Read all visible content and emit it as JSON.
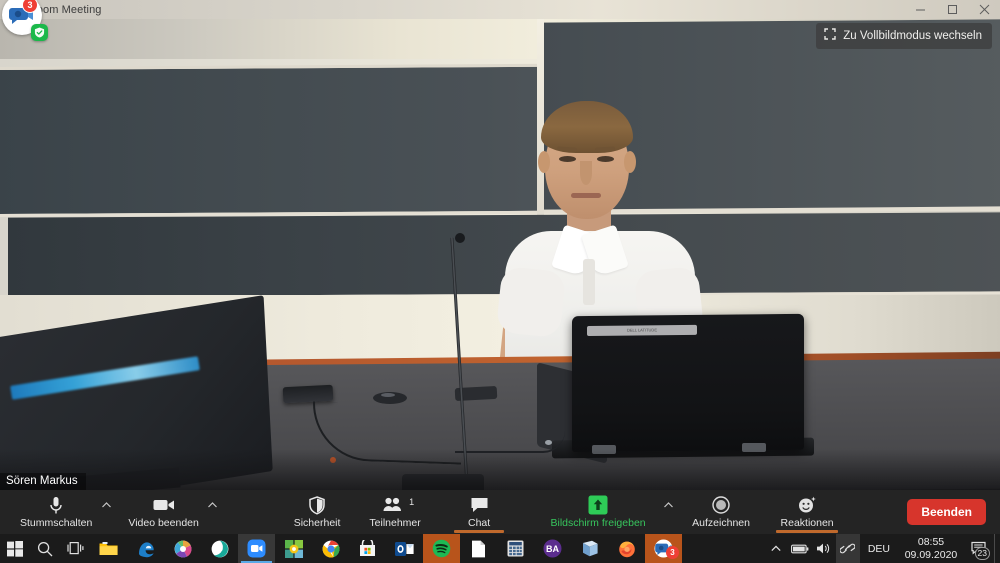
{
  "window": {
    "title": "Zoom Meeting",
    "controls": {
      "minimize": "minimize-icon",
      "maximize": "maximize-icon",
      "close": "close-icon"
    }
  },
  "overlay": {
    "app_icon": "zoom-chat-bubble-icon",
    "notification_count": "3",
    "shield_icon": "shield-check-icon"
  },
  "video": {
    "fullscreen_label": "Zu Vollbildmodus wechseln",
    "fullscreen_icon": "expand-icon",
    "participant_name": "Sören Markus",
    "laptop_strip_text": "DELL LATITUDE"
  },
  "toolbar": {
    "mute": {
      "label": "Stummschalten",
      "icon": "microphone-icon"
    },
    "video": {
      "label": "Video beenden",
      "icon": "video-camera-icon"
    },
    "security": {
      "label": "Sicherheit",
      "icon": "shield-icon"
    },
    "participants": {
      "label": "Teilnehmer",
      "icon": "people-icon",
      "count": "1"
    },
    "chat": {
      "label": "Chat",
      "icon": "chat-bubble-icon",
      "active": true
    },
    "share": {
      "label": "Bildschirm freigeben",
      "icon": "share-screen-icon",
      "color": "#37c55d"
    },
    "record": {
      "label": "Aufzeichnen",
      "icon": "record-circle-icon"
    },
    "reactions": {
      "label": "Reaktionen",
      "icon": "smiley-reaction-icon",
      "active": true
    },
    "end": {
      "label": "Beenden",
      "color": "#d7352c"
    },
    "caret_icon": "chevron-up-icon",
    "active_underline_color": "#c0692c"
  },
  "taskbar": {
    "start": "windows-start-icon",
    "search": "search-icon",
    "taskview": "task-view-icon",
    "apps": [
      {
        "name": "file-explorer",
        "glyph": "",
        "color": "#ffb900"
      },
      {
        "name": "microsoft-edge-legacy",
        "glyph": "e",
        "color": "#1a74c4"
      },
      {
        "name": "colorful-circle-app",
        "glyph": "",
        "color": "#d94a8c"
      },
      {
        "name": "teal-circle-app",
        "glyph": "",
        "color": "#18a999"
      },
      {
        "name": "zoom",
        "glyph": "",
        "color": "#2d8cff",
        "active": true
      },
      {
        "name": "green-yellow-squares-app",
        "glyph": "",
        "color": "#7cc242"
      },
      {
        "name": "google-chrome",
        "glyph": "",
        "color": "#4285f4"
      },
      {
        "name": "microsoft-store",
        "glyph": "",
        "color": "#ffffff"
      },
      {
        "name": "outlook",
        "glyph": "O",
        "color": "#0f4b8f"
      },
      {
        "name": "spotify",
        "glyph": "",
        "color": "#1db954",
        "active_orange": true
      },
      {
        "name": "document-app",
        "glyph": "",
        "color": "#ffffff"
      },
      {
        "name": "calculator",
        "glyph": "",
        "color": "#3f6fa8"
      },
      {
        "name": "ba-app",
        "glyph": "BA",
        "color": "#5b2d8e"
      },
      {
        "name": "blue-book-app",
        "glyph": "",
        "color": "#9dc3e6"
      },
      {
        "name": "firefox",
        "glyph": "",
        "color": "#ff7139"
      },
      {
        "name": "zoom-chat",
        "glyph": "",
        "color": "#2d8cff",
        "active_orange": true,
        "badge": "3"
      }
    ],
    "tray": {
      "chevron": "chevron-up-icon",
      "battery": "battery-icon",
      "volume": "volume-icon",
      "bluetooth": "link-icon",
      "language": "DEU",
      "time": "08:55",
      "date": "09.09.2020",
      "notifications_icon": "action-center-icon",
      "notifications_count": "23"
    }
  }
}
